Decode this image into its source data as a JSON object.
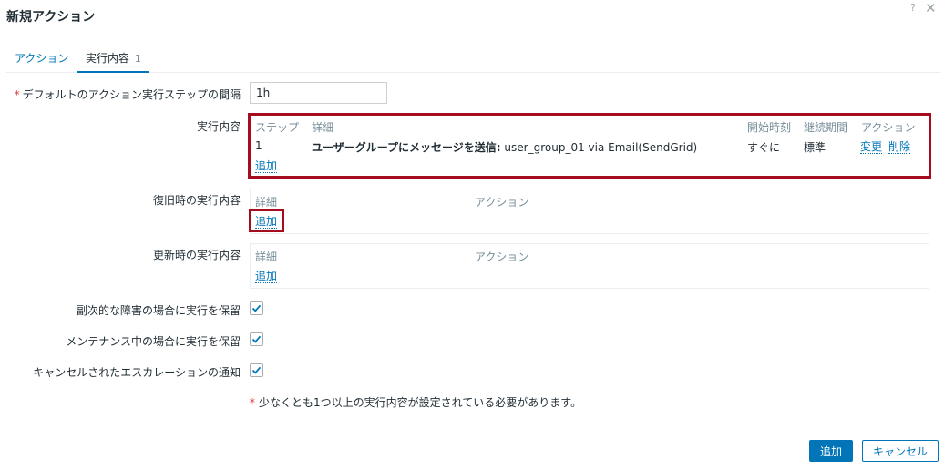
{
  "dialog": {
    "title": "新規アクション",
    "help": "?",
    "close": "✕"
  },
  "tabs": [
    {
      "label": "アクション"
    },
    {
      "label": "実行内容",
      "count": "1"
    }
  ],
  "form": {
    "required_mark": "*",
    "step_interval_label": "デフォルトのアクション実行ステップの間隔",
    "step_interval_value": "1h",
    "operations_label": "実行内容",
    "operations": {
      "headers": {
        "step": "ステップ",
        "details": "詳細",
        "start": "開始時刻",
        "duration": "継続期間",
        "action": "アクション"
      },
      "rows": [
        {
          "step": "1",
          "details_bold": "ユーザーグループにメッセージを送信:",
          "details_rest": " user_group_01 via Email(SendGrid)",
          "start": "すぐに",
          "duration": "標準",
          "edit": "変更",
          "remove": "削除"
        }
      ],
      "add": "追加"
    },
    "recovery_label": "復旧時の実行内容",
    "recovery": {
      "headers": {
        "details": "詳細",
        "action": "アクション"
      },
      "add": "追加"
    },
    "update_label": "更新時の実行内容",
    "update": {
      "headers": {
        "details": "詳細",
        "action": "アクション"
      },
      "add": "追加"
    },
    "pause_symptoms_label": "副次的な障害の場合に実行を保留",
    "pause_symptoms_checked": true,
    "pause_suppressed_label": "メンテナンス中の場合に実行を保留",
    "pause_suppressed_checked": true,
    "notify_cancelled_label": "キャンセルされたエスカレーションの通知",
    "notify_cancelled_checked": true,
    "note_mark": "*",
    "note": "少なくとも1つ以上の実行内容が設定されている必要があります。"
  },
  "buttons": {
    "add": "追加",
    "cancel": "キャンセル"
  },
  "colors": {
    "accent": "#0275b8",
    "highlight": "#a50d1f",
    "required": "#e33734"
  }
}
